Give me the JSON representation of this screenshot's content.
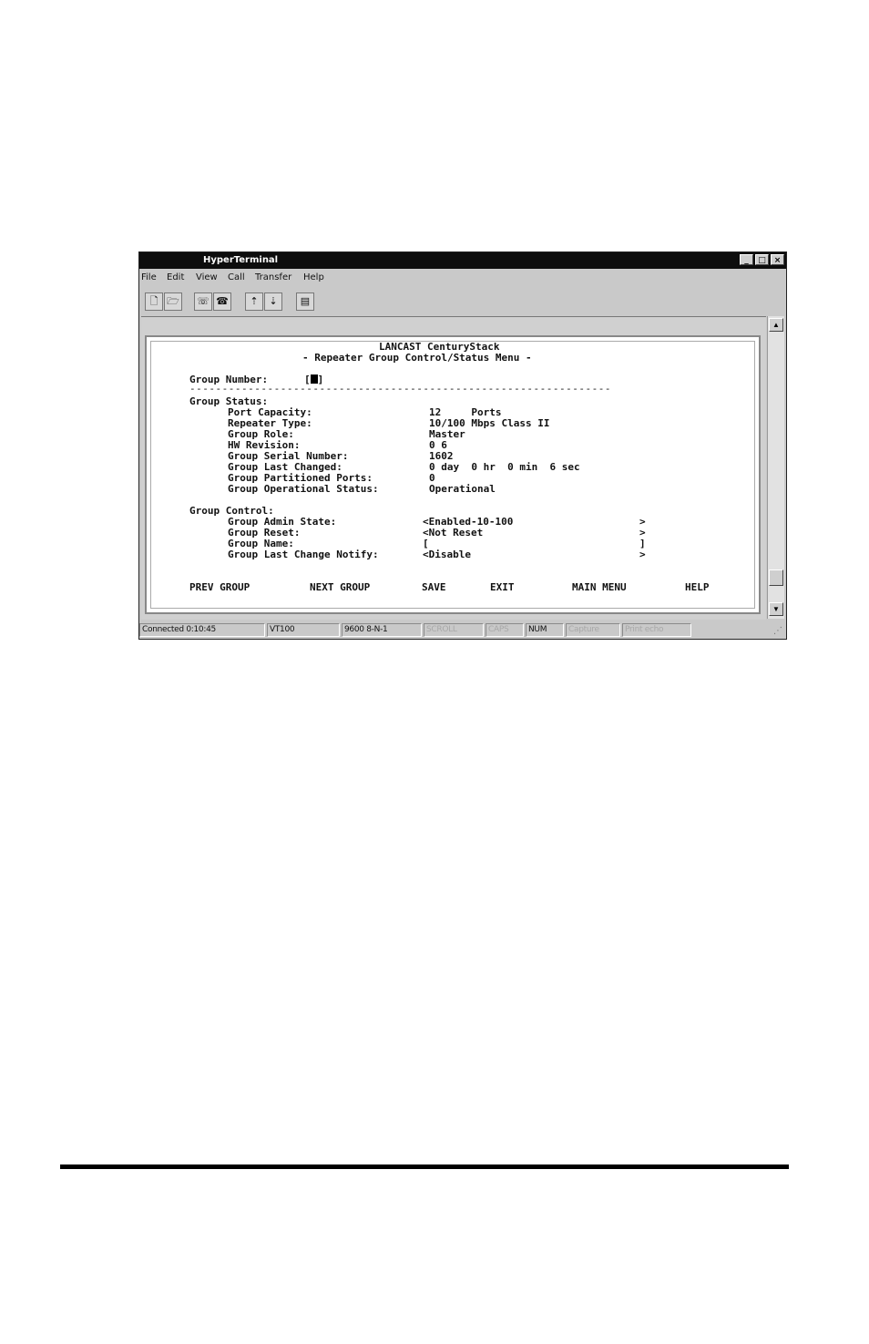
{
  "window": {
    "title": "HyperTerminal",
    "buttons": [
      "_",
      "□",
      "×"
    ]
  },
  "menu": [
    "File",
    "Edit",
    "View",
    "Call",
    "Transfer",
    "Help"
  ],
  "toolbar": [
    "new-icon",
    "open-icon",
    "connect-icon",
    "disconnect-icon",
    "send-icon",
    "receive-icon",
    "properties-icon"
  ],
  "terminal": {
    "header_line1": "LANCAST CenturyStack",
    "header_line2": "- Repeater Group Control/Status Menu -",
    "group_number_label": "Group Number:",
    "group_number_open": "[",
    "group_number_close": "]",
    "separator": "-----------------------------------------------------------------",
    "status_heading": "Group Status:",
    "status": [
      {
        "label": "Port Capacity:",
        "value": "12     Ports"
      },
      {
        "label": "Repeater Type:",
        "value": "10/100 Mbps Class II"
      },
      {
        "label": "Group Role:",
        "value": "Master"
      },
      {
        "label": "HW Revision:",
        "value": "0 6"
      },
      {
        "label": "Group Serial Number:",
        "value": "1602"
      },
      {
        "label": "Group Last Changed:",
        "value": "0 day  0 hr  0 min  6 sec"
      },
      {
        "label": "Group Partitioned Ports:",
        "value": "0"
      },
      {
        "label": "Group Operational Status:",
        "value": "Operational"
      }
    ],
    "control_heading": "Group Control:",
    "control": [
      {
        "label": "Group Admin State:",
        "value": "<Enabled-10-100",
        "close": ">"
      },
      {
        "label": "Group Reset:",
        "value": "<Not Reset",
        "close": ">"
      },
      {
        "label": "Group Name:",
        "value": "[",
        "close": "]"
      },
      {
        "label": "Group Last Change Notify:",
        "value": "<Disable",
        "close": ">"
      }
    ],
    "commands": [
      "PREV GROUP",
      "NEXT GROUP",
      "SAVE",
      "EXIT",
      "MAIN MENU",
      "HELP"
    ]
  },
  "status_bar": [
    "Connected 0:10:45",
    "VT100",
    "9600 8-N-1",
    "SCROLL",
    "CAPS",
    "NUM",
    "Capture",
    "Print echo"
  ]
}
